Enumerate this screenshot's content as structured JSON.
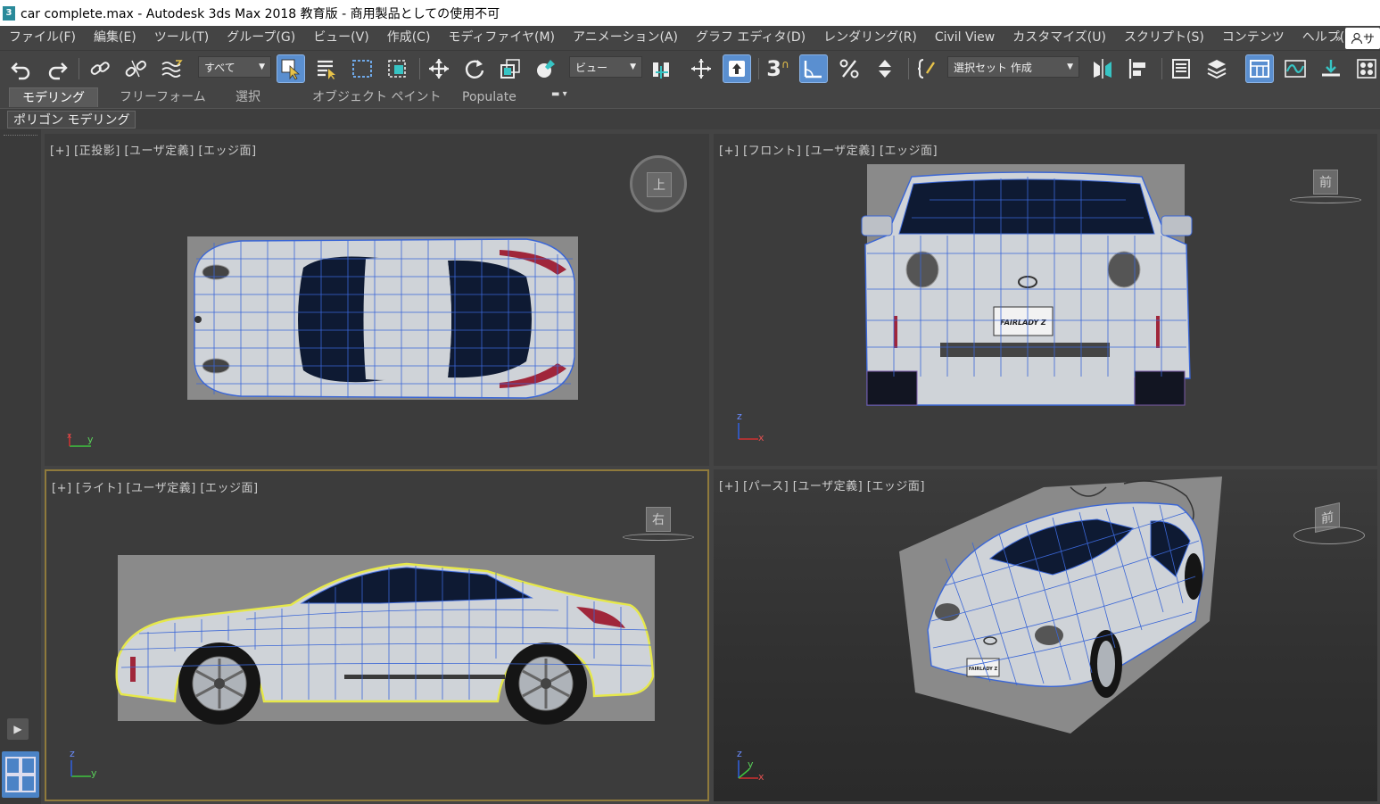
{
  "window": {
    "title": "car complete.max - Autodesk 3ds Max 2018 教育版 - 商用製品としての使用不可",
    "app_icon": "3"
  },
  "menu": [
    "ファイル(F)",
    "編集(E)",
    "ツール(T)",
    "グループ(G)",
    "ビュー(V)",
    "作成(C)",
    "モディファイヤ(M)",
    "アニメーション(A)",
    "グラフ エディタ(D)",
    "レンダリング(R)",
    "Civil View",
    "カスタマイズ(U)",
    "スクリプト(S)",
    "コンテンツ",
    "ヘルプ(H)"
  ],
  "menu_more": "»",
  "user_label": "サ",
  "toolbar": {
    "filter_label": "すべて",
    "refcoord_label": "ビュー",
    "selset_label": "選択セット 作成",
    "snap_label": "3"
  },
  "ribbon_tabs": [
    "モデリング",
    "フリーフォーム",
    "選択",
    "オブジェクト ペイント",
    "Populate"
  ],
  "ribbon_active": "モデリング",
  "ribbon_panel": "ポリゴン モデリング",
  "viewports": {
    "top": {
      "label": "[+] [正投影] [ユーザ定義] [エッジ面]",
      "axis1": "y",
      "axis2": "x",
      "cube": "上"
    },
    "front": {
      "label": "[+] [フロント] [ユーザ定義] [エッジ面]",
      "axis1": "z",
      "axis2": "x",
      "cube": "前",
      "plate": "FAIRLADY Z"
    },
    "right": {
      "label": "[+] [ライト] [ユーザ定義] [エッジ面]",
      "axis1": "z",
      "axis2": "y",
      "cube": "右"
    },
    "persp": {
      "label": "[+] [パース] [ユーザ定義] [エッジ面]",
      "axis1": "z",
      "axis2": "y",
      "axis3": "x",
      "cube": "前",
      "plate": "FAIRLADY Z"
    }
  },
  "colors": {
    "accent": "#5a8fd0",
    "mesh": "#3a66d6",
    "selection": "#e6e84a",
    "body": "#cfd3d8"
  }
}
